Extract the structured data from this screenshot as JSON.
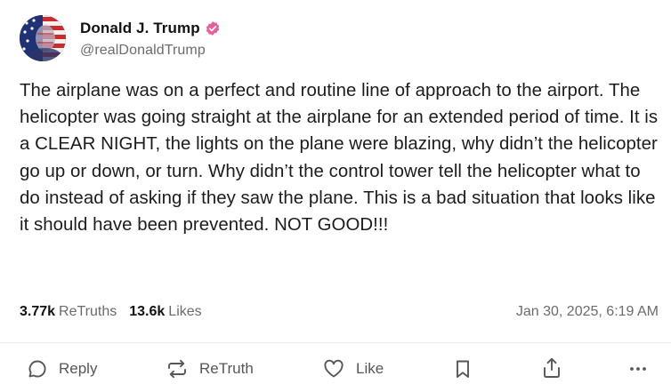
{
  "author": {
    "display_name": "Donald J. Trump",
    "handle": "@realDonaldTrump",
    "verified_icon": "verified-badge-icon",
    "accent_color": "#e85d9a"
  },
  "post": {
    "text": "The airplane was on a perfect and routine line of approach to the airport. The helicopter was going straight at the airplane for an extended period of time. It is a CLEAR NIGHT, the lights on the plane were blazing, why didn’t the helicopter go up or down, or turn. Why didn’t the control tower tell the helicopter what to do instead of asking if they saw the plane. This is a bad situation that looks like it should have been prevented. NOT GOOD!!!"
  },
  "stats": {
    "retruths_count": "3.77k",
    "retruths_label": "ReTruths",
    "likes_count": "13.6k",
    "likes_label": "Likes",
    "timestamp": "Jan 30, 2025, 6:19 AM"
  },
  "actions": {
    "reply": "Reply",
    "retruth": "ReTruth",
    "like": "Like",
    "icons": [
      "reply-icon",
      "retruth-icon",
      "heart-icon",
      "bookmark-icon",
      "share-icon",
      "more-icon"
    ]
  }
}
